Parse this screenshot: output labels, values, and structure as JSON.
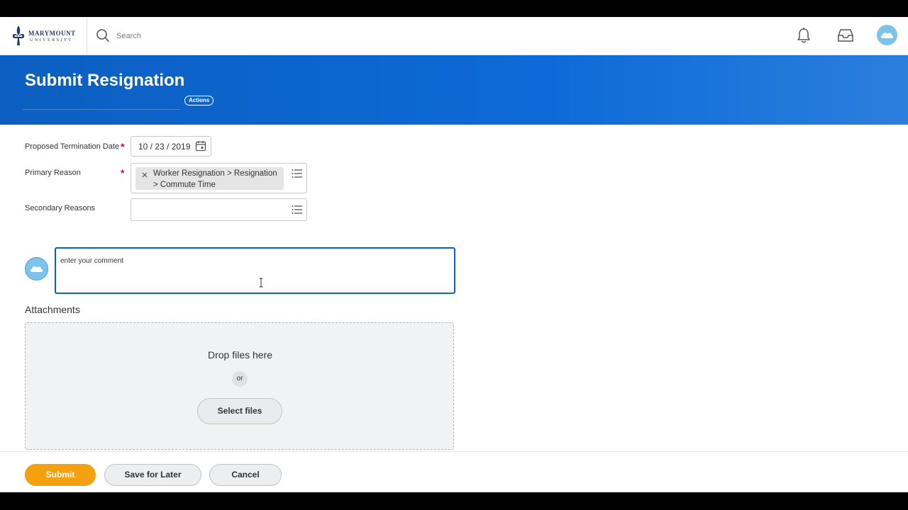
{
  "header": {
    "logo_line1": "MARYMOUNT",
    "logo_line2": "UNIVERSITY",
    "search_placeholder": "Search"
  },
  "banner": {
    "title": "Submit Resignation",
    "actions_label": "Actions"
  },
  "form": {
    "termination_date": {
      "label": "Proposed Termination Date",
      "value": "10 / 23 / 2019",
      "required": true
    },
    "primary_reason": {
      "label": "Primary Reason",
      "value": "Worker Resignation > Resignation > Commute Time",
      "required": true
    },
    "secondary_reasons": {
      "label": "Secondary Reasons",
      "value": ""
    }
  },
  "comment": {
    "placeholder": "enter your comment"
  },
  "attachments": {
    "title": "Attachments",
    "drop_text": "Drop files here",
    "or_text": "or",
    "select_label": "Select files"
  },
  "footer": {
    "submit_label": "Submit",
    "save_label": "Save for Later",
    "cancel_label": "Cancel"
  },
  "colors": {
    "brand_blue": "#0b5fc1",
    "submit_orange": "#f5a00f",
    "required_red": "#c8102e",
    "avatar_blue": "#7ec3ec"
  },
  "icons": [
    "fleur-de-lis-logo",
    "search-icon",
    "bell-icon",
    "inbox-icon",
    "avatar",
    "calendar-icon",
    "close-icon",
    "list-icon",
    "text-cursor-icon"
  ]
}
